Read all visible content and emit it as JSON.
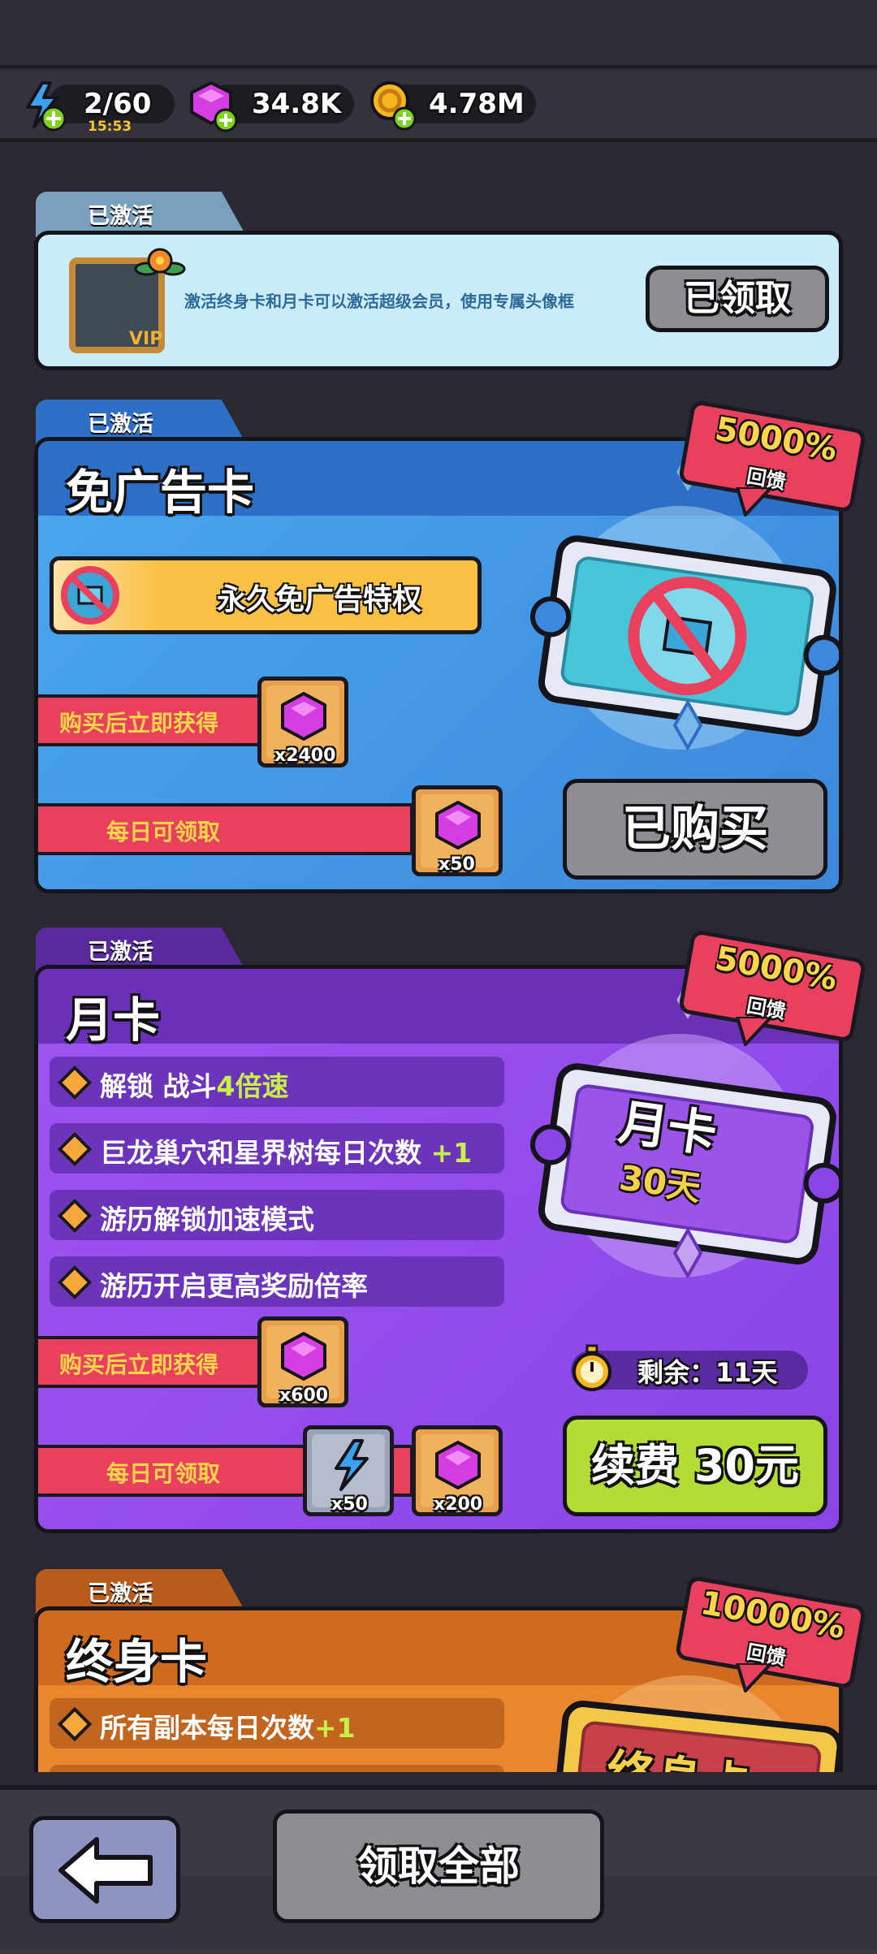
{
  "resources": {
    "energy": {
      "value": "2/60",
      "timer": "15:53",
      "icon": "lightning-plus-icon"
    },
    "gems": {
      "value": "34.8K",
      "icon": "gem-plus-icon"
    },
    "coins": {
      "value": "4.78M",
      "icon": "coin-plus-icon"
    }
  },
  "vip_card": {
    "tab": "已激活",
    "description": "激活终身卡和月卡可以激活超级会员，使用专属头像框",
    "button": "已领取",
    "frame_label": "VIP"
  },
  "noad_card": {
    "tab": "已激活",
    "title": "免广告卡",
    "privilege": "永久免广告特权",
    "badge_pct": "5000%",
    "badge_sub": "回馈",
    "instant_label": "购买后立即获得",
    "instant_count": "x2400",
    "daily_label": "每日可领取",
    "daily_count": "x50",
    "button": "已购买"
  },
  "monthly_card": {
    "tab": "已激活",
    "title": "月卡",
    "features": [
      {
        "text": "解锁 战斗",
        "highlight": "4倍速"
      },
      {
        "text": "巨龙巢穴和星界树每日次数 ",
        "highlight": "+1"
      },
      {
        "text": "游历解锁加速模式",
        "highlight": ""
      },
      {
        "text": "游历开启更高奖励倍率",
        "highlight": ""
      }
    ],
    "ticket_title": "月卡",
    "ticket_days": "30天",
    "badge_pct": "5000%",
    "badge_sub": "回馈",
    "instant_label": "购买后立即获得",
    "instant_count": "x600",
    "daily_label": "每日可领取",
    "daily_energy_count": "x50",
    "daily_gem_count": "x200",
    "remaining": "剩余：11天",
    "button": "续费 30元"
  },
  "lifetime_card": {
    "tab": "已激活",
    "title": "终身卡",
    "features": [
      {
        "text": "所有副本每日次数",
        "highlight": "+1"
      }
    ],
    "ticket_title": "终身卡",
    "badge_pct": "10000%",
    "badge_sub": "回馈"
  },
  "footer": {
    "claim_all": "领取全部",
    "back_icon": "back-arrow-icon"
  },
  "colors": {
    "blue_card": "#3f8fe0",
    "purple_card": "#8a45e6",
    "orange_card": "#e8872e",
    "badge_red": "#e9405e",
    "renew_green": "#b3dd35",
    "highlight_green": "#c8f04a"
  }
}
